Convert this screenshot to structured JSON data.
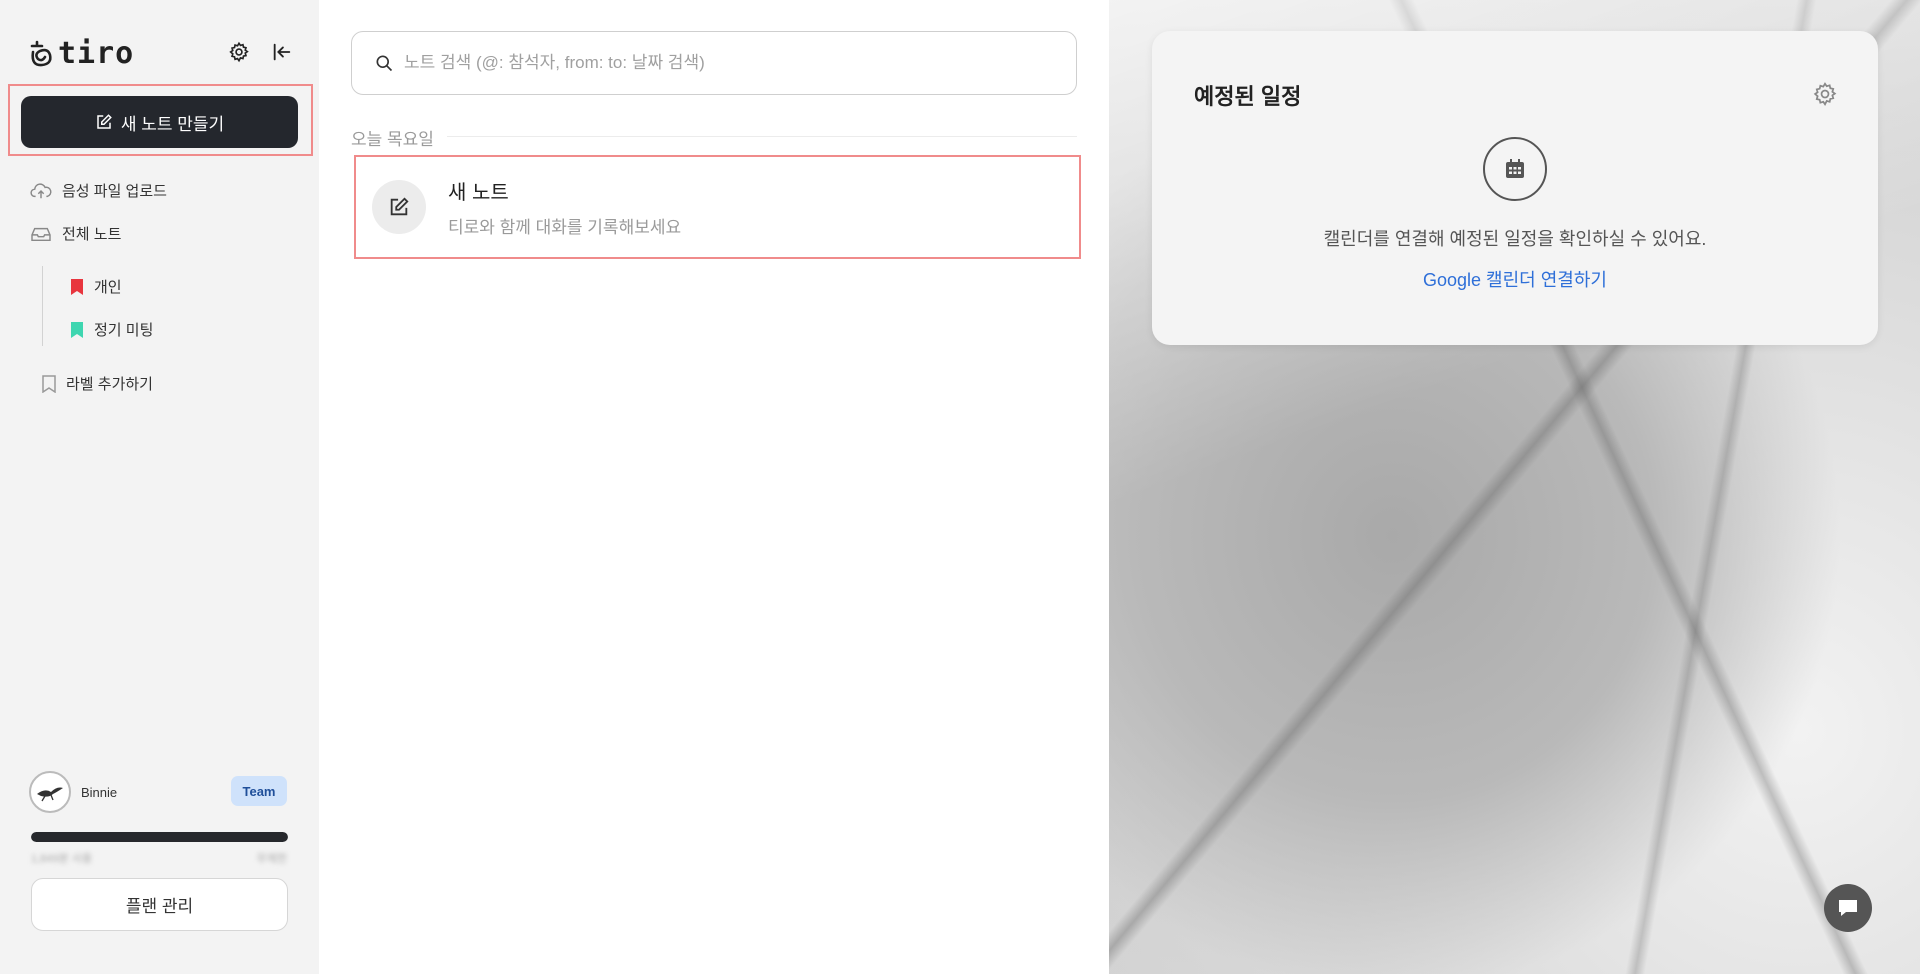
{
  "sidebar": {
    "logo_text": "tiro",
    "new_note_label": "새 노트 만들기",
    "upload_label": "음성 파일 업로드",
    "all_notes_label": "전체 노트",
    "labels": [
      {
        "name": "개인",
        "color": "#e8353e"
      },
      {
        "name": "정기 미팅",
        "color": "#3ed6b0"
      }
    ],
    "add_label": "라벨 추가하기",
    "user": {
      "name": "Binnie",
      "plan": "Team"
    },
    "usage": {
      "left_text": "1,849분 사용",
      "right_text": "무제한",
      "fraction": 1.0
    },
    "plan_button": "플랜 관리"
  },
  "main": {
    "search_placeholder": "노트 검색 (@: 참석자, from: to: 날짜 검색)",
    "day_label": "오늘 목요일",
    "note": {
      "title": "새 노트",
      "subtitle": "티로와 함께 대화를 기록해보세요"
    }
  },
  "calendar": {
    "title": "예정된 일정",
    "message": "캘린더를 연결해 예정된 일정을 확인하실 수 있어요.",
    "link": "Google 캘린더 연결하기"
  },
  "colors": {
    "accent_dark": "#24272d",
    "link_blue": "#2e6fd8",
    "highlight": "#f08b8b",
    "team_badge_bg": "#cfe2fb"
  }
}
